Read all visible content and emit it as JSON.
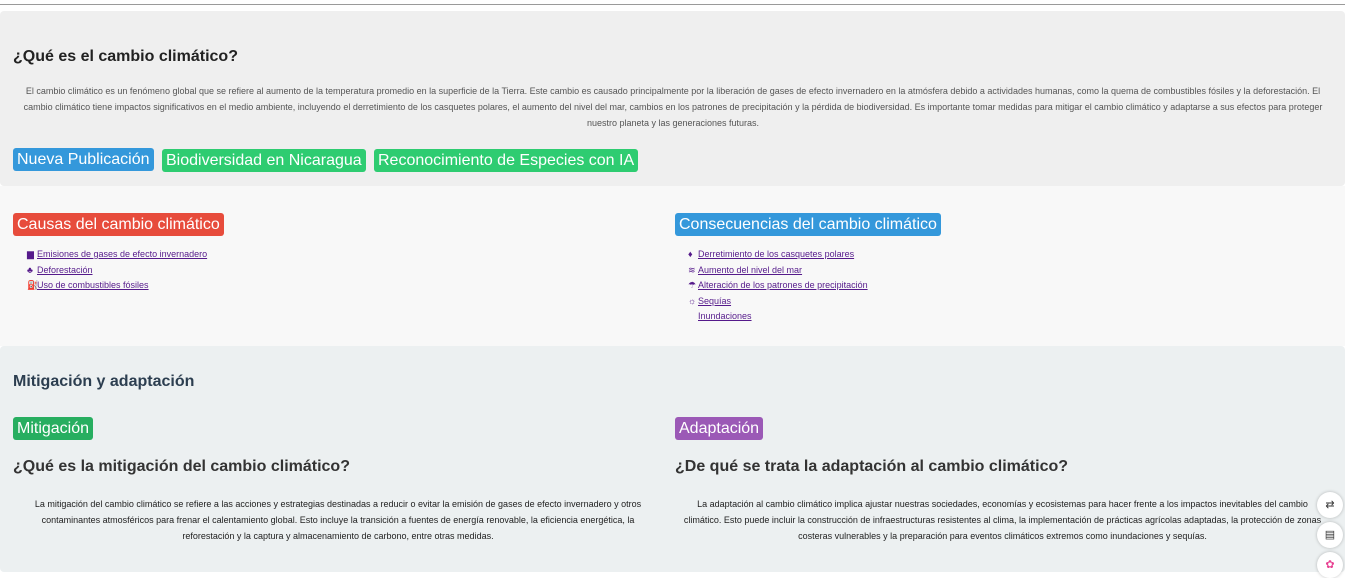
{
  "intro": {
    "title": "¿Qué es el cambio climático?",
    "text": "El cambio climático es un fenómeno global que se refiere al aumento de la temperatura promedio en la superficie de la Tierra. Este cambio es causado principalmente por la liberación de gases de efecto invernadero en la atmósfera debido a actividades humanas, como la quema de combustibles fósiles y la deforestación. El cambio climático tiene impactos significativos en el medio ambiente, incluyendo el derretimiento de los casquetes polares, el aumento del nivel del mar, cambios en los patrones de precipitación y la pérdida de biodiversidad. Es importante tomar medidas para mitigar el cambio climático y adaptarse a sus efectos para proteger nuestro planeta y las generaciones futuras.",
    "buttons": [
      {
        "label": "Nueva Publicación",
        "color": "#3498db"
      },
      {
        "label": "Biodiversidad en Nicaragua",
        "color": "#2ecc71"
      },
      {
        "label": "Reconocimiento de Especies con IA",
        "color": "#2ecc71"
      }
    ]
  },
  "causes": {
    "title": "Causas del cambio climático",
    "color": "#e74c3c",
    "items": [
      {
        "icon": "factory-icon",
        "glyph": "▆",
        "label": "Emisiones de gases de efecto invernadero"
      },
      {
        "icon": "tree-icon",
        "glyph": "♣",
        "label": "Deforestación"
      },
      {
        "icon": "fuel-pump-icon",
        "glyph": "⛽",
        "label": "Uso de combustibles fósiles"
      }
    ]
  },
  "consequences": {
    "title": "Consecuencias del cambio climático",
    "color": "#3498db",
    "items": [
      {
        "icon": "temperature-icon",
        "glyph": "♦",
        "label": "Derretimiento de los casquetes polares"
      },
      {
        "icon": "water-icon",
        "glyph": "≋",
        "label": "Aumento del nivel del mar"
      },
      {
        "icon": "cloud-rain-icon",
        "glyph": "☂",
        "label": "Alteración de los patrones de precipitación"
      },
      {
        "icon": "sun-icon",
        "glyph": "☼",
        "label": "Sequías"
      },
      {
        "icon": "flood-icon",
        "glyph": "",
        "label": "Inundaciones"
      }
    ]
  },
  "mitigation": {
    "section_title": "Mitigación y adaptación",
    "mit_badge": "Mitigación",
    "mit_color": "#27ae60",
    "mit_heading": "¿Qué es la mitigación del cambio climático?",
    "mit_text": "La mitigación del cambio climático se refiere a las acciones y estrategias destinadas a reducir o evitar la emisión de gases de efecto invernadero y otros contaminantes atmosféricos para frenar el calentamiento global. Esto incluye la transición a fuentes de energía renovable, la eficiencia energética, la reforestación y la captura y almacenamiento de carbono, entre otras medidas.",
    "ada_badge": "Adaptación",
    "ada_color": "#9b59b6",
    "ada_heading": "¿De qué se trata la adaptación al cambio climático?",
    "ada_text": "La adaptación al cambio climático implica ajustar nuestras sociedades, economías y ecosistemas para hacer frente a los impactos inevitables del cambio climático. Esto puede incluir la construcción de infraestructuras resistentes al clima, la implementación de prácticas agrícolas adaptadas, la protección de zonas costeras vulnerables y la preparación para eventos climáticos extremos como inundaciones y sequías."
  },
  "side_tools": [
    {
      "icon": "translate-icon",
      "glyph": "⇄"
    },
    {
      "icon": "reader-icon",
      "glyph": "▤"
    },
    {
      "icon": "brain-icon",
      "glyph": "✿"
    }
  ]
}
